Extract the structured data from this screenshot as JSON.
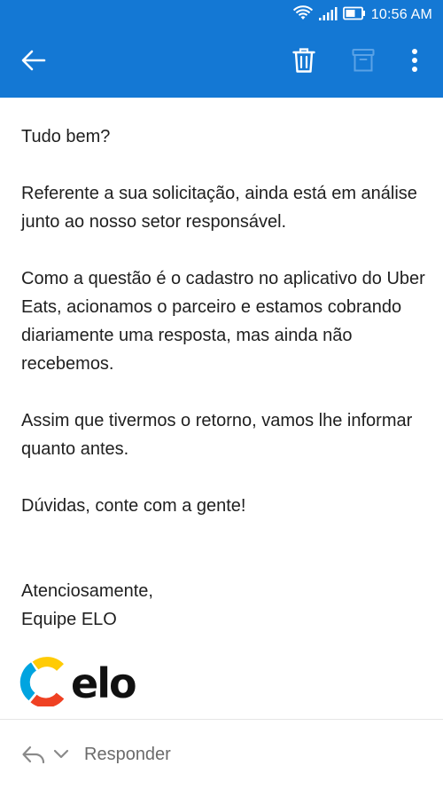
{
  "status_bar": {
    "time": "10:56 AM"
  },
  "toolbar": {
    "back_icon": "arrow-left-icon",
    "delete_icon": "trash-icon",
    "archive_icon": "archive-icon",
    "more_icon": "more-vertical-icon"
  },
  "email": {
    "greeting": "Tudo bem?",
    "paragraph1": "Referente a sua solicitação, ainda está em análise junto ao nosso setor responsável.",
    "paragraph2": "Como a questão é o cadastro no aplicativo do Uber Eats, acionamos o parceiro e estamos cobrando diariamente uma resposta, mas ainda não recebemos.",
    "paragraph3": "Assim que tivermos o retorno, vamos lhe informar quanto antes.",
    "paragraph4": "Dúvidas, conte com a gente!",
    "signoff": "Atenciosamente,",
    "signature": "Equipe ELO",
    "logo_text": "elo"
  },
  "reply_bar": {
    "label": "Responder"
  },
  "colors": {
    "app_bar": "#1478d4",
    "text": "#1f1f1f",
    "elo_blue": "#00a4e0",
    "elo_yellow": "#ffcb05",
    "elo_red": "#ef4123"
  }
}
